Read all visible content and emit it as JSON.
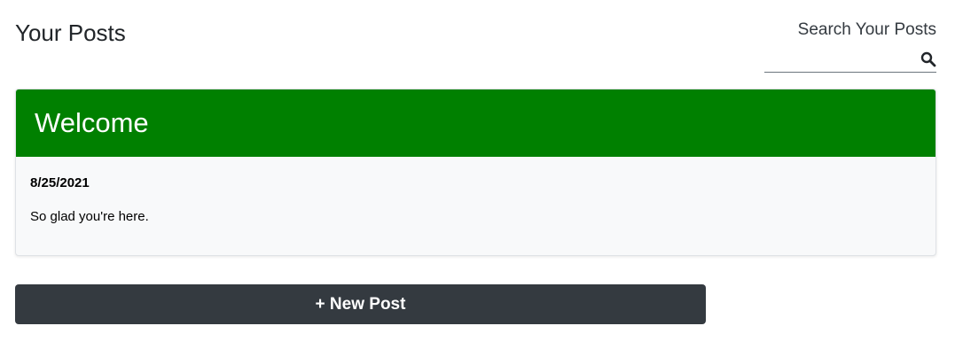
{
  "header": {
    "title": "Your Posts"
  },
  "search": {
    "label": "Search Your Posts",
    "value": "",
    "icon": "search-icon"
  },
  "posts": [
    {
      "title": "Welcome",
      "date": "8/25/2021",
      "body": "So glad you're here.",
      "header_color": "#008000"
    }
  ],
  "actions": {
    "new_post_label": "+ New Post",
    "button_color": "#343a40"
  }
}
